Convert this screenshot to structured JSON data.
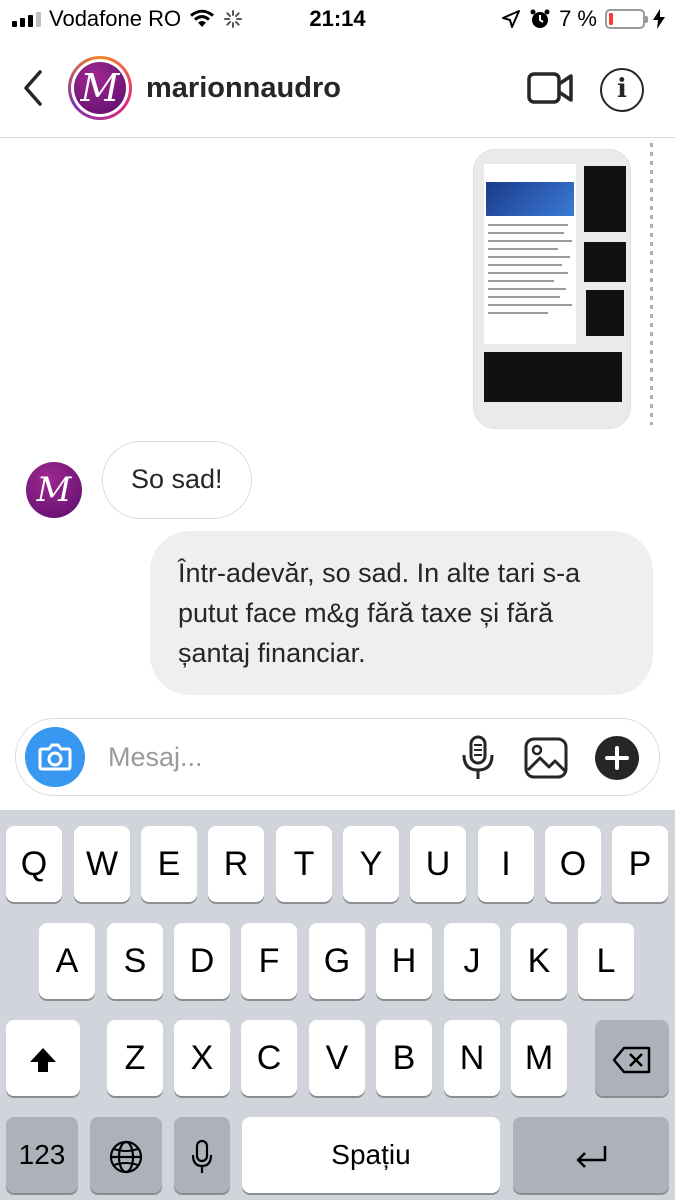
{
  "status_bar": {
    "carrier": "Vodafone RO",
    "time": "21:14",
    "battery_percent": "7 %",
    "battery_level": 0.07
  },
  "header": {
    "username": "marionnaudro",
    "avatar_letter": "M"
  },
  "conversation": {
    "shared_image_icon": "shared-screenshot-image",
    "messages": [
      {
        "sender": "marionnaudro",
        "text": "So sad!"
      },
      {
        "sender": "me",
        "text": "Într-adevăr, so sad. In alte tari s-a putut face m&g fără taxe și fără șantaj financiar."
      }
    ]
  },
  "composer": {
    "placeholder": "Mesaj...",
    "accent": "#3897f0"
  },
  "keyboard": {
    "row1": [
      "Q",
      "W",
      "E",
      "R",
      "T",
      "Y",
      "U",
      "I",
      "O",
      "P"
    ],
    "row2": [
      "A",
      "S",
      "D",
      "F",
      "G",
      "H",
      "J",
      "K",
      "L"
    ],
    "row3": [
      "Z",
      "X",
      "C",
      "V",
      "B",
      "N",
      "M"
    ],
    "numbers_key": "123",
    "space_label": "Spațiu"
  }
}
